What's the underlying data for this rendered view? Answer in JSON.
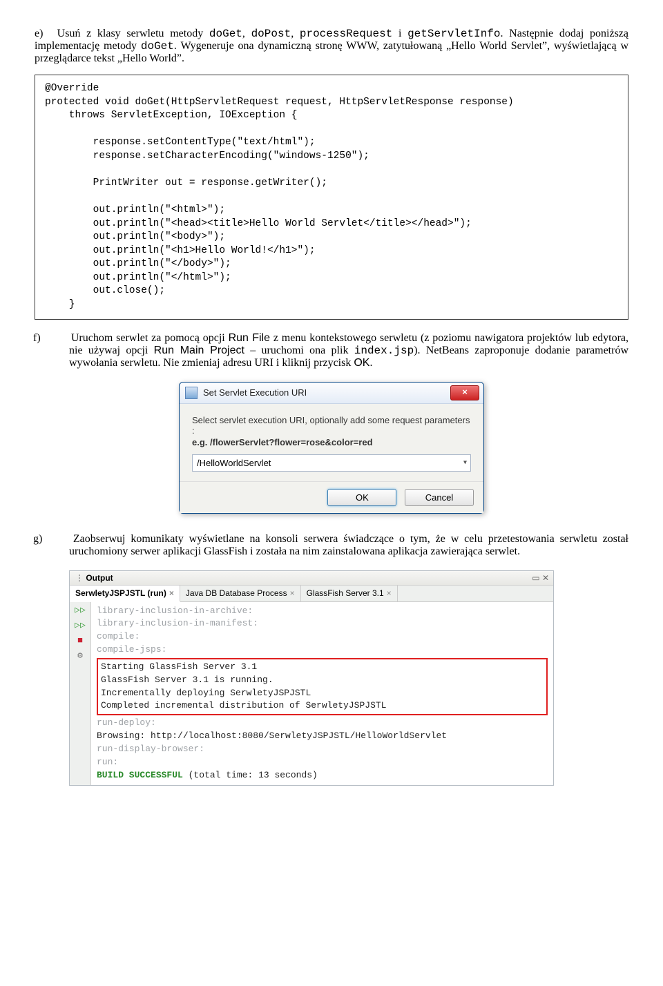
{
  "item_e": {
    "marker": "e)",
    "text_pre": "Usuń z klasy serwletu metody ",
    "m1": "doGet",
    "sep1": ", ",
    "m2": "doPost",
    "sep2": ", ",
    "m3": "processRequest",
    "sep3": " i ",
    "m4": "getServletInfo",
    "text_mid": ". Następnie dodaj poniższą implementację metody ",
    "m5": "doGet",
    "text_post": ". Wygeneruje ona dynamiczną stronę WWW, zatytułowaną „Hello World Servlet”, wyświetlającą w przeglądarce tekst „Hello World”."
  },
  "code": "@Override\nprotected void doGet(HttpServletRequest request, HttpServletResponse response)\n    throws ServletException, IOException {\n\n        response.setContentType(\"text/html\");\n        response.setCharacterEncoding(\"windows-1250\");\n\n        PrintWriter out = response.getWriter();\n\n        out.println(\"<html>\");\n        out.println(\"<head><title>Hello World Servlet</title></head>\");\n        out.println(\"<body>\");\n        out.println(\"<h1>Hello World!</h1>\");\n        out.println(\"</body>\");\n        out.println(\"</html>\");\n        out.close();\n    }",
  "item_f": {
    "marker": "f)",
    "t1": "Uruchom serwlet za pomocą opcji ",
    "runfile": "Run File",
    "t2": " z menu kontekstowego serwletu (z poziomu nawigatora projektów lub edytora, nie używaj opcji ",
    "runmain": "Run Main Project",
    "t3": " – uruchomi ona plik ",
    "indexjsp": "index.jsp",
    "t4": "). NetBeans zaproponuje dodanie parametrów wywołania serwletu. Nie zmieniaj adresu URI i kliknij przycisk ",
    "ok": "OK",
    "t5": "."
  },
  "dialog": {
    "title": "Set Servlet Execution URI",
    "close": "×",
    "hint": "Select servlet execution URI, optionally add some request parameters :",
    "example": "e.g. /flowerServlet?flower=rose&color=red",
    "value": "/HelloWorldServlet",
    "ok": "OK",
    "cancel": "Cancel"
  },
  "item_g": {
    "marker": "g)",
    "text": "Zaobserwuj komunikaty wyświetlane na konsoli serwera świadczące o tym, że w celu przetestowania serwletu został uruchomiony serwer aplikacji GlassFish i została na nim zainstalowana aplikacja zawierająca serwlet."
  },
  "output": {
    "header": "Output",
    "tabs": {
      "t1": "SerwletyJSPJSTL (run)",
      "t2": "Java DB Database Process",
      "t3": "GlassFish Server 3.1"
    },
    "gutter": {
      "i1": "▷▷",
      "i2": "▷▷",
      "i3": "■",
      "i4": "⚙"
    },
    "lines": {
      "l1": "library-inclusion-in-archive:",
      "l2": "library-inclusion-in-manifest:",
      "l3": "compile:",
      "l4": "compile-jsps:",
      "l5": "Starting GlassFish Server 3.1",
      "l6": "GlassFish Server 3.1 is running.",
      "l7": "Incrementally deploying SerwletyJSPJSTL",
      "l8": "Completed incremental distribution of SerwletyJSPJSTL",
      "l9": "run-deploy:",
      "l10": "Browsing: http://localhost:8080/SerwletyJSPJSTL/HelloWorldServlet",
      "l11": "run-display-browser:",
      "l12": "run:",
      "l13a": "BUILD SUCCESSFUL",
      "l13b": " (total time: 13 seconds)"
    }
  }
}
